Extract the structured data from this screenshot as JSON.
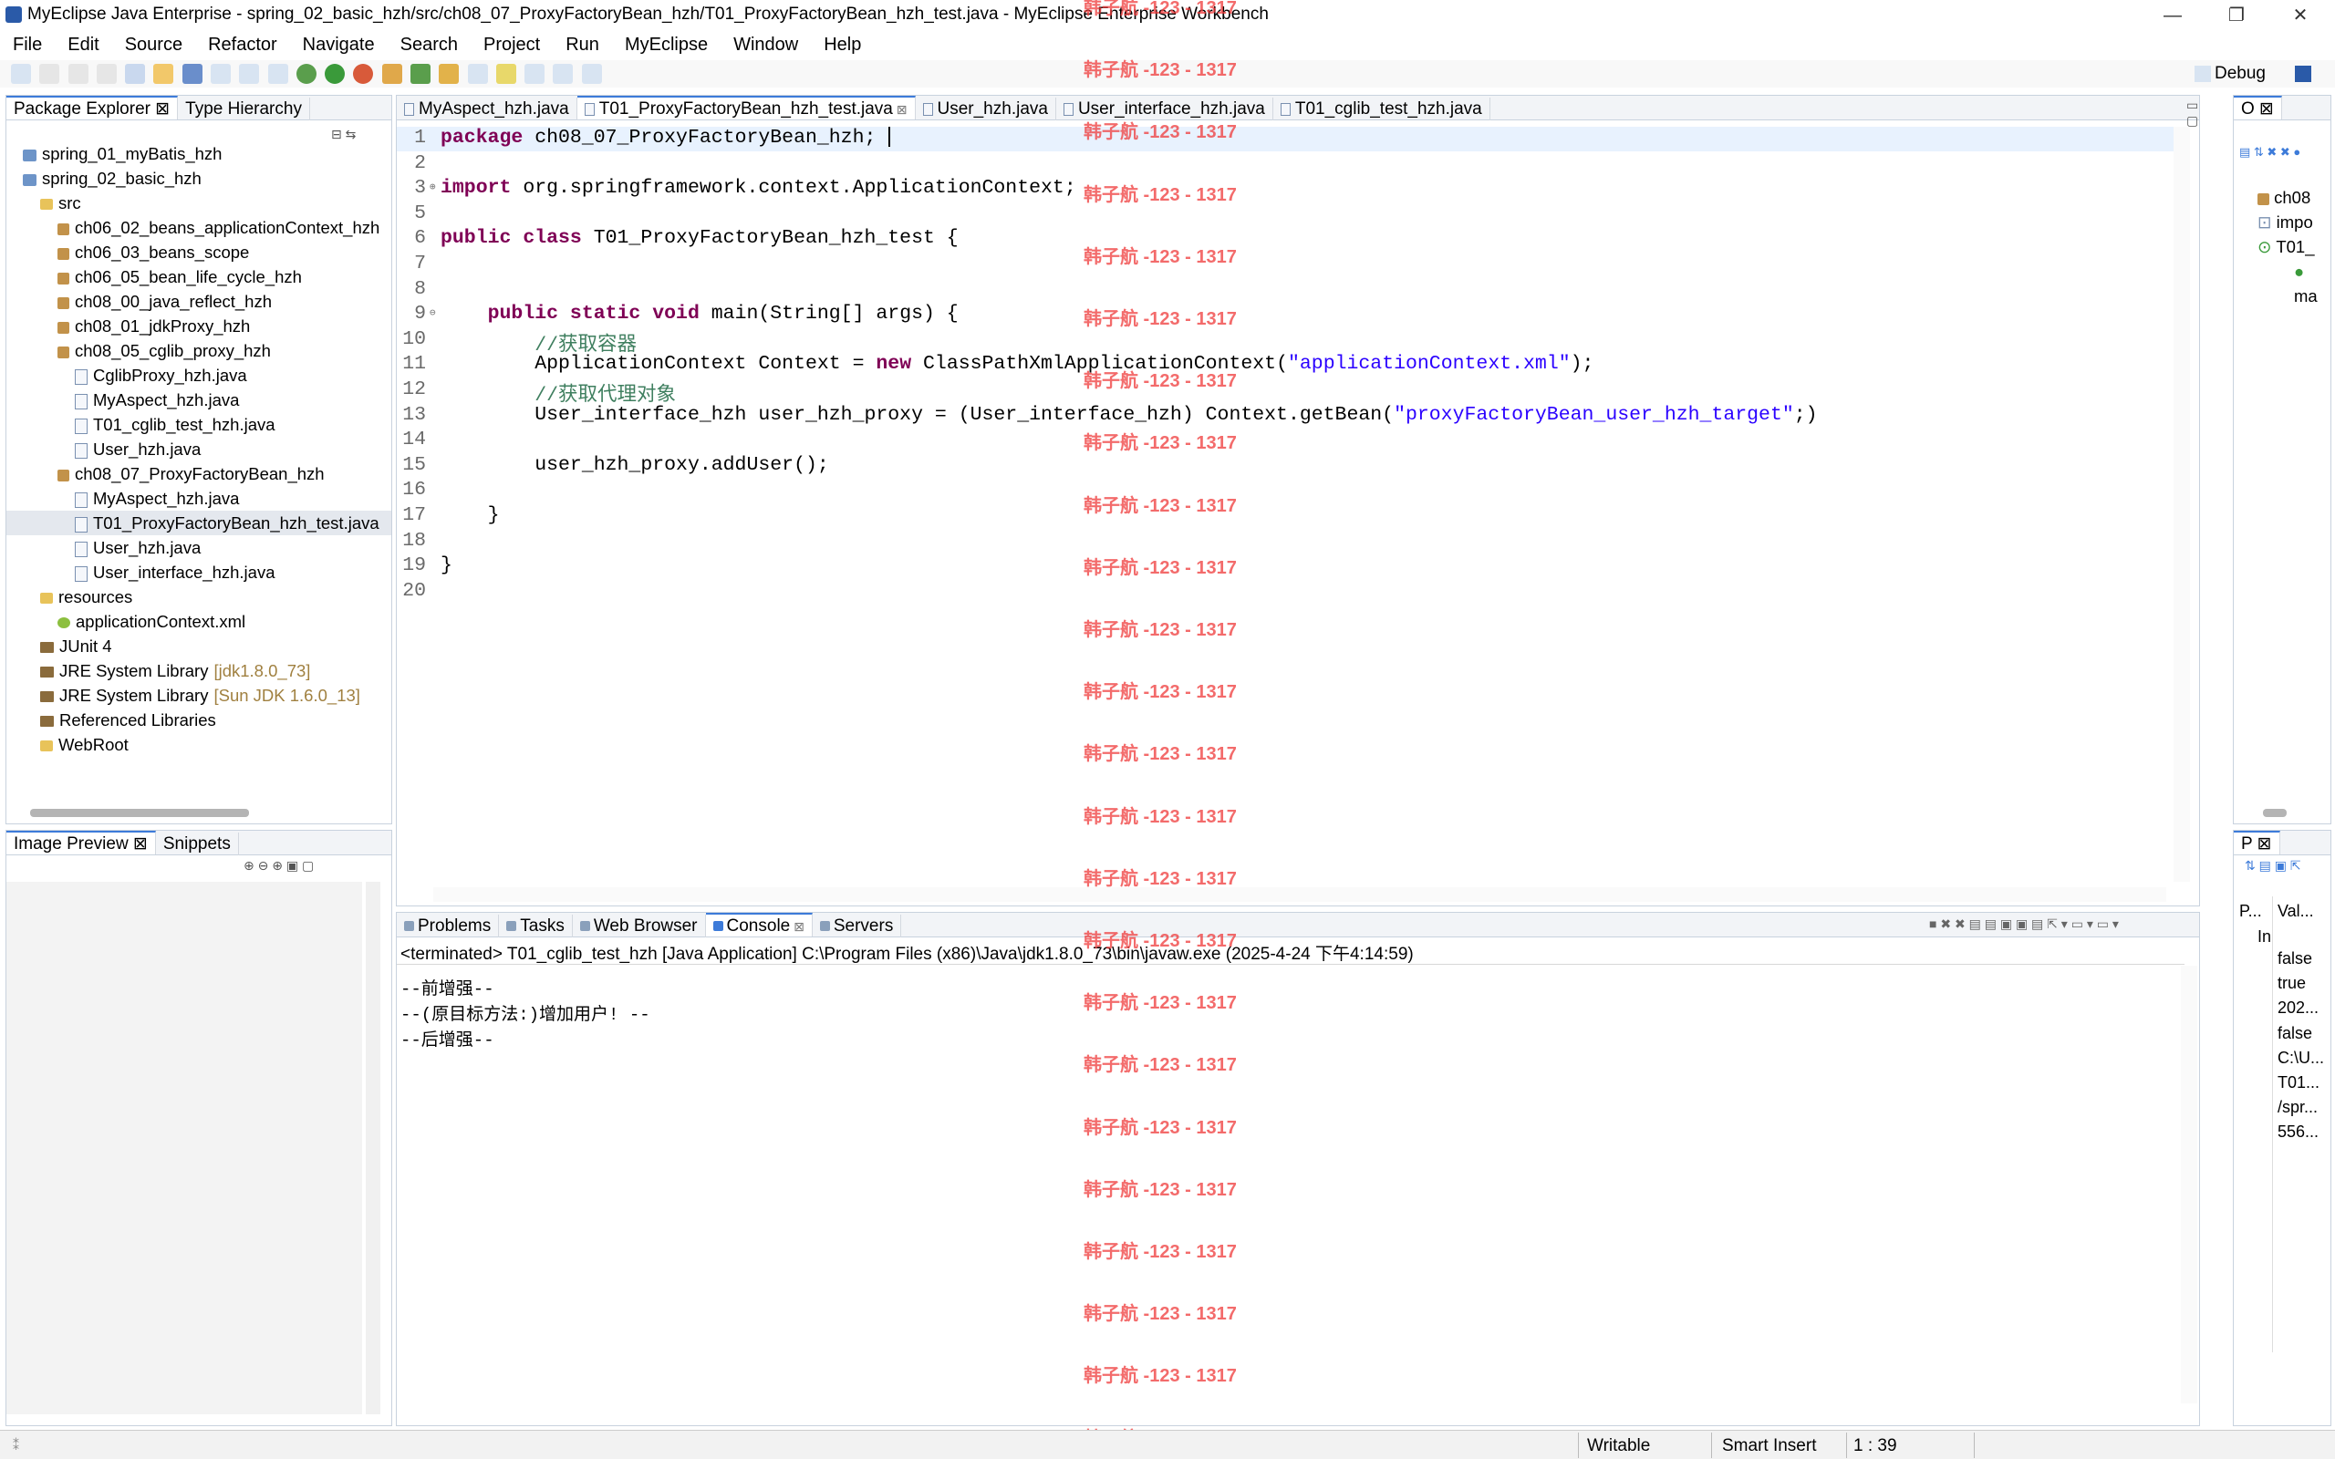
{
  "window": {
    "title": "MyEclipse Java Enterprise - spring_02_basic_hzh/src/ch08_07_ProxyFactoryBean_hzh/T01_ProxyFactoryBean_hzh_test.java - MyEclipse Enterprise Workbench"
  },
  "menu": [
    "File",
    "Edit",
    "Source",
    "Refactor",
    "Navigate",
    "Search",
    "Project",
    "Run",
    "MyEclipse",
    "Window",
    "Help"
  ],
  "perspective": {
    "label": "Debug"
  },
  "explorer": {
    "tabs": [
      "Package Explorer",
      "Type Hierarchy"
    ],
    "tree": [
      {
        "label": "spring_01_myBatis_hzh",
        "indent": 0,
        "icon": "project"
      },
      {
        "label": "spring_02_basic_hzh",
        "indent": 0,
        "icon": "project"
      },
      {
        "label": "src",
        "indent": 1,
        "icon": "folder"
      },
      {
        "label": "ch06_02_beans_applicationContext_hzh",
        "indent": 2,
        "icon": "package"
      },
      {
        "label": "ch06_03_beans_scope",
        "indent": 2,
        "icon": "package"
      },
      {
        "label": "ch06_05_bean_life_cycle_hzh",
        "indent": 2,
        "icon": "package"
      },
      {
        "label": "ch08_00_java_reflect_hzh",
        "indent": 2,
        "icon": "package"
      },
      {
        "label": "ch08_01_jdkProxy_hzh",
        "indent": 2,
        "icon": "package"
      },
      {
        "label": "ch08_05_cglib_proxy_hzh",
        "indent": 2,
        "icon": "package"
      },
      {
        "label": "CglibProxy_hzh.java",
        "indent": 3,
        "icon": "java"
      },
      {
        "label": "MyAspect_hzh.java",
        "indent": 3,
        "icon": "java"
      },
      {
        "label": "T01_cglib_test_hzh.java",
        "indent": 3,
        "icon": "java"
      },
      {
        "label": "User_hzh.java",
        "indent": 3,
        "icon": "java"
      },
      {
        "label": "ch08_07_ProxyFactoryBean_hzh",
        "indent": 2,
        "icon": "package"
      },
      {
        "label": "MyAspect_hzh.java",
        "indent": 3,
        "icon": "java"
      },
      {
        "label": "T01_ProxyFactoryBean_hzh_test.java",
        "indent": 3,
        "icon": "java",
        "selected": true
      },
      {
        "label": "User_hzh.java",
        "indent": 3,
        "icon": "java"
      },
      {
        "label": "User_interface_hzh.java",
        "indent": 3,
        "icon": "java"
      },
      {
        "label": "resources",
        "indent": 1,
        "icon": "folder"
      },
      {
        "label": "applicationContext.xml",
        "indent": 2,
        "icon": "xml"
      },
      {
        "label": "JUnit 4",
        "indent": 1,
        "icon": "library"
      },
      {
        "label": "JRE System Library",
        "suffix": "[jdk1.8.0_73]",
        "indent": 1,
        "icon": "library"
      },
      {
        "label": "JRE System Library",
        "suffix": "[Sun JDK 1.6.0_13]",
        "indent": 1,
        "icon": "library"
      },
      {
        "label": "Referenced Libraries",
        "indent": 1,
        "icon": "library"
      },
      {
        "label": "WebRoot",
        "indent": 1,
        "icon": "folder"
      }
    ]
  },
  "preview": {
    "tabs": [
      "Image Preview",
      "Snippets"
    ]
  },
  "editor": {
    "tabs": [
      "MyAspect_hzh.java",
      "T01_ProxyFactoryBean_hzh_test.java",
      "User_hzh.java",
      "User_interface_hzh.java",
      "T01_cglib_test_hzh.java"
    ],
    "active_tab": 1,
    "line_numbers": [
      "1",
      "2",
      "3",
      "5",
      "6",
      "7",
      "8",
      "9",
      "10",
      "11",
      "12",
      "13",
      "14",
      "15",
      "16",
      "17",
      "18",
      "19",
      "20"
    ],
    "code": [
      [
        {
          "k": "kw",
          "t": "package"
        },
        {
          "k": "",
          "t": " ch08_07_ProxyFactoryBean_hzh;"
        }
      ],
      [],
      [
        {
          "k": "kw",
          "t": "import"
        },
        {
          "k": "",
          "t": " org.springframework.context.ApplicationContext;"
        }
      ],
      [],
      [
        {
          "k": "kw",
          "t": "public class"
        },
        {
          "k": "",
          "t": " T01_ProxyFactoryBean_hzh_test {"
        }
      ],
      [],
      [],
      [
        {
          "k": "",
          "t": "    "
        },
        {
          "k": "kw",
          "t": "public static void"
        },
        {
          "k": "",
          "t": " main(String[] args) {"
        }
      ],
      [
        {
          "k": "",
          "t": "        "
        },
        {
          "k": "cm",
          "t": "//获取容器"
        }
      ],
      [
        {
          "k": "",
          "t": "        ApplicationContext Context = "
        },
        {
          "k": "kw",
          "t": "new"
        },
        {
          "k": "",
          "t": " ClassPathXmlApplicationContext("
        },
        {
          "k": "str",
          "t": "\"applicationContext.xml\""
        },
        {
          "k": "",
          "t": ");"
        }
      ],
      [
        {
          "k": "",
          "t": "        "
        },
        {
          "k": "cm",
          "t": "//获取代理对象"
        }
      ],
      [
        {
          "k": "",
          "t": "        User_interface_hzh user_hzh_proxy = (User_interface_hzh) Context.getBean("
        },
        {
          "k": "str",
          "t": "\"proxyFactoryBean_user_hzh_target\""
        },
        {
          "k": "",
          "t": ";)"
        }
      ],
      [],
      [
        {
          "k": "",
          "t": "        user_hzh_proxy.addUser();"
        }
      ],
      [],
      [
        {
          "k": "",
          "t": "    }"
        }
      ],
      [],
      [
        {
          "k": "",
          "t": "}"
        }
      ],
      []
    ]
  },
  "watermark": {
    "text": "韩子航 -123 - 1317"
  },
  "console": {
    "tabs": [
      "Problems",
      "Tasks",
      "Web Browser",
      "Console",
      "Servers"
    ],
    "header": "<terminated> T01_cglib_test_hzh [Java Application] C:\\Program Files (x86)\\Java\\jdk1.8.0_73\\bin\\javaw.exe (2025-4-24 下午4:14:59)",
    "lines": [
      "--前增强--",
      "--(原目标方法:)增加用户! --",
      "--后增强--"
    ]
  },
  "outline": {
    "tab": "O",
    "items": [
      "ch08",
      "impo",
      "T01_",
      "ma"
    ]
  },
  "properties": {
    "tab": "P",
    "headers": [
      "P...",
      "Val..."
    ],
    "group": "In",
    "values": [
      "false",
      "true",
      "202...",
      "false",
      "C:\\U...",
      "T01...",
      "/spr...",
      "556..."
    ]
  },
  "status": {
    "writable": "Writable",
    "insert": "Smart Insert",
    "position": "1 : 39"
  },
  "colors": {
    "accent": "#3d7bd9",
    "keyword": "#7f0055",
    "string": "#2a00ff",
    "comment": "#3f7f5f",
    "watermark": "#ef3a3a"
  }
}
